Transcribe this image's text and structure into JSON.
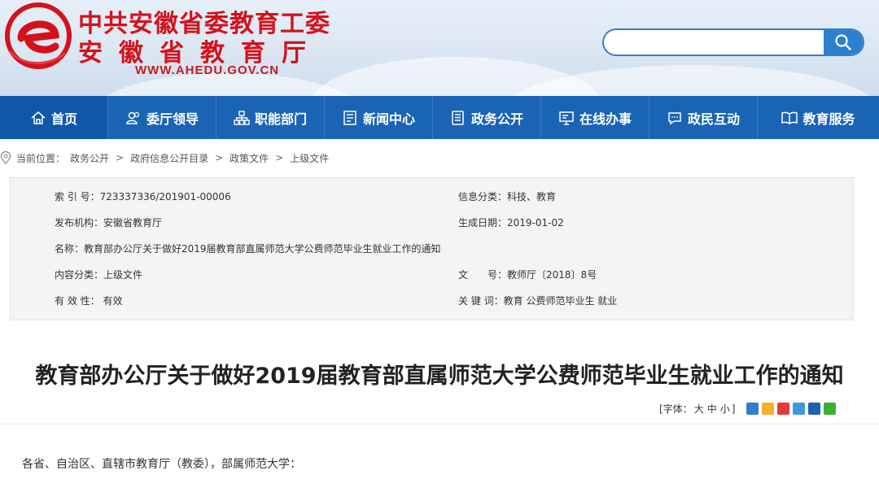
{
  "header": {
    "org_line1": "中共安徽省委教育工委",
    "org_line2": "安徽省教育厅",
    "url": "WWW.AHEDU.GOV.CN",
    "logo_icon": "ahedu-e-logo-icon",
    "brand_red": "#d4121b",
    "search": {
      "value": "",
      "placeholder": "",
      "icon": "search-icon"
    }
  },
  "nav": {
    "color": "#1a64b6",
    "items": [
      {
        "label": "首页",
        "icon": "home-icon"
      },
      {
        "label": "委厅领导",
        "icon": "leaders-icon"
      },
      {
        "label": "职能部门",
        "icon": "org-chart-icon"
      },
      {
        "label": "新闻中心",
        "icon": "news-icon"
      },
      {
        "label": "政务公开",
        "icon": "document-list-icon"
      },
      {
        "label": "在线办事",
        "icon": "monitor-icon"
      },
      {
        "label": "政民互动",
        "icon": "chat-icon"
      },
      {
        "label": "教育服务",
        "icon": "book-icon"
      }
    ]
  },
  "breadcrumb": {
    "prefix": "当前位置：",
    "items": [
      "政务公开",
      "政府信息公开目录",
      "政策文件",
      "上级文件"
    ],
    "separator": ">"
  },
  "info": {
    "index_no": "索 引 号：723337336/201901-00006",
    "category": "信息分类：科技、教育",
    "publisher": "发布机构：安徽省教育厅",
    "date": "生成日期：2019-01-02",
    "name": "名称：教育部办公厅关于做好2019届教育部直属师范大学公费师范毕业生就业工作的通知",
    "content_type": "内容分类：上级文件",
    "doc_no_label": "文　　号：",
    "doc_no": "教师厅〔2018〕8号",
    "validity": "有 效 性： 有效",
    "keywords": "关 键 词：教育 公费师范毕业生 就业"
  },
  "article": {
    "title": "教育部办公厅关于做好2019届教育部直属师范大学公费师范毕业生就业工作的通知",
    "font_size_prefix": "[字体：",
    "font_large": "大",
    "font_medium": "中",
    "font_small": "小",
    "font_size_suffix": "]",
    "share_icons": [
      "share-plus-icon",
      "qzone-icon",
      "weibo-icon",
      "tencent-weibo-icon",
      "renren-icon",
      "wechat-icon"
    ],
    "salutation": "各省、自治区、直辖市教育厅（教委），部属师范大学："
  }
}
